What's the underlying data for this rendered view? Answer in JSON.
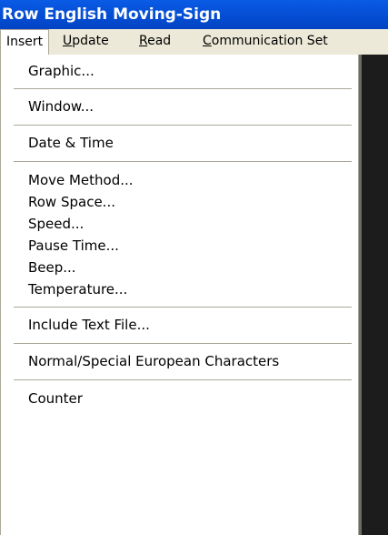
{
  "window": {
    "title": "Row English Moving-Sign"
  },
  "menubar": {
    "items": [
      {
        "label": "Insert"
      },
      {
        "label_first": "U",
        "label_rest": "pdate"
      },
      {
        "label_first": "R",
        "label_rest": "ead"
      },
      {
        "label_first": "C",
        "label_rest": "ommunication Set"
      }
    ]
  },
  "insert_menu": {
    "items": [
      "Graphic...",
      "Window...",
      "Date & Time",
      "Move Method...",
      "Row Space...",
      "Speed...",
      "Pause Time...",
      "Beep...",
      "Temperature...",
      "Include Text File...",
      "Normal/Special European Characters",
      "Counter"
    ]
  },
  "colors": {
    "titlebar": "#0550d6",
    "menubar": "#ece9d8",
    "separator": "#aca899"
  }
}
